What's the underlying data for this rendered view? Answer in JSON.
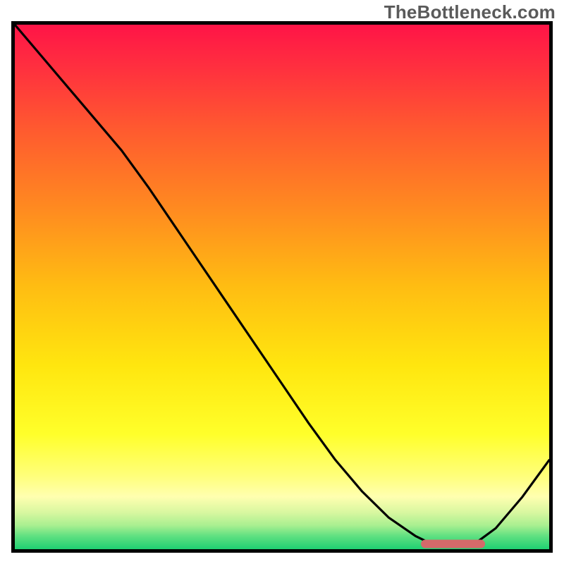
{
  "watermark": "TheBottleneck.com",
  "chart_data": {
    "type": "line",
    "title": "",
    "xlabel": "",
    "ylabel": "",
    "xlim": [
      0,
      100
    ],
    "ylim": [
      0,
      100
    ],
    "x": [
      0,
      5,
      10,
      15,
      20,
      25,
      30,
      35,
      40,
      45,
      50,
      55,
      60,
      65,
      70,
      75,
      78,
      82,
      86,
      90,
      95,
      100
    ],
    "y": [
      100,
      94,
      88,
      82,
      76,
      69,
      61.5,
      54,
      46.5,
      39,
      31.5,
      24,
      17,
      11,
      6,
      2.5,
      1,
      0.5,
      1,
      4,
      10,
      17
    ],
    "curve_color": "#000000",
    "background_gradient_stops": [
      {
        "offset": 0.0,
        "color": "#ff1447"
      },
      {
        "offset": 0.08,
        "color": "#ff2f3f"
      },
      {
        "offset": 0.2,
        "color": "#ff5a2f"
      },
      {
        "offset": 0.35,
        "color": "#ff8a20"
      },
      {
        "offset": 0.5,
        "color": "#ffbd12"
      },
      {
        "offset": 0.65,
        "color": "#ffe60f"
      },
      {
        "offset": 0.78,
        "color": "#ffff2a"
      },
      {
        "offset": 0.86,
        "color": "#ffff7a"
      },
      {
        "offset": 0.9,
        "color": "#ffffb0"
      },
      {
        "offset": 0.93,
        "color": "#d8f7a0"
      },
      {
        "offset": 0.955,
        "color": "#a8ef90"
      },
      {
        "offset": 0.975,
        "color": "#5fe081"
      },
      {
        "offset": 1.0,
        "color": "#1fd072"
      }
    ],
    "optimal_marker": {
      "x_start": 76,
      "x_end": 88,
      "y": 1.0,
      "color": "#d46a6a",
      "thickness_px": 12
    }
  }
}
